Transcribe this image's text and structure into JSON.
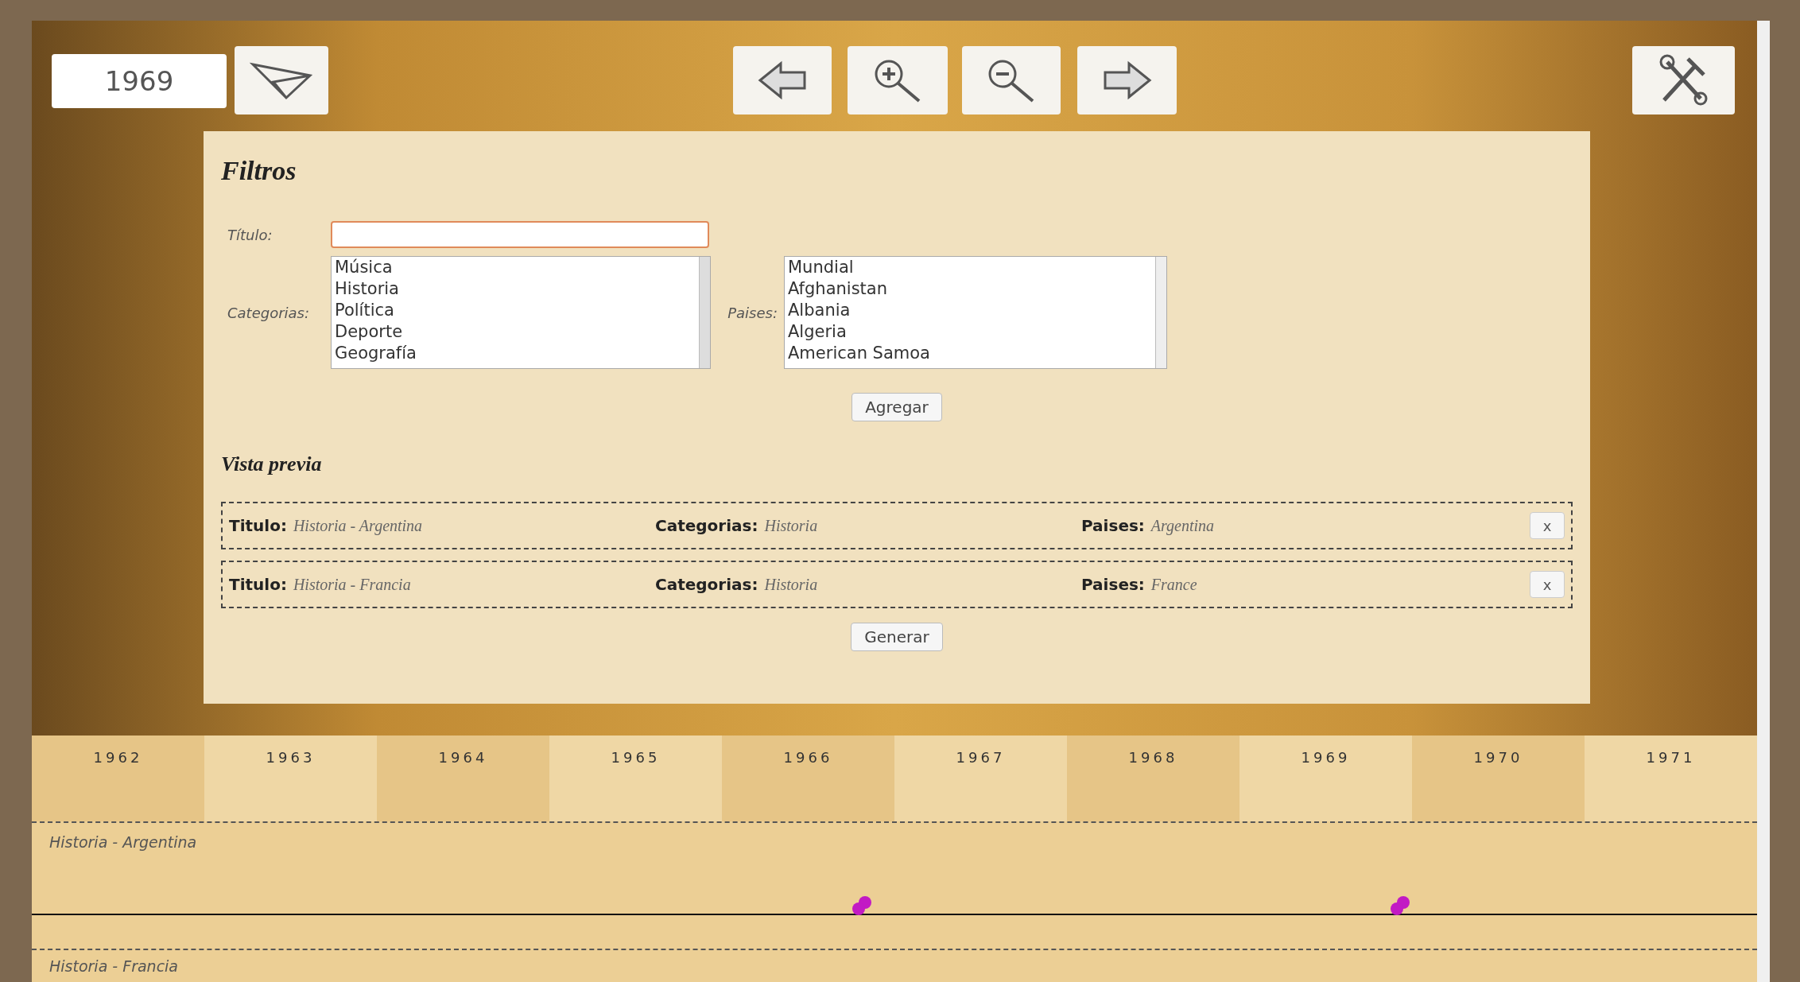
{
  "toolbar": {
    "year": "1969"
  },
  "filters": {
    "title": "Filtros",
    "title_field": {
      "label": "Título:"
    },
    "categories": {
      "label": "Categorias:",
      "options": [
        "Música",
        "Historia",
        "Política",
        "Deporte",
        "Geografía"
      ]
    },
    "countries": {
      "label": "Paises:",
      "options": [
        "Mundial",
        "Afghanistan",
        "Albania",
        "Algeria",
        "American Samoa"
      ]
    },
    "add_button": "Agregar",
    "preview_title": "Vista previa",
    "preview_rows": [
      {
        "title_label": "Titulo:",
        "title": "Historia - Argentina",
        "categories_label": "Categorias:",
        "categories": "Historia",
        "countries_label": "Paises:",
        "countries": "Argentina",
        "remove": "x"
      },
      {
        "title_label": "Titulo:",
        "title": "Historia - Francia",
        "categories_label": "Categorias:",
        "categories": "Historia",
        "countries_label": "Paises:",
        "countries": "France",
        "remove": "x"
      }
    ],
    "generate_button": "Generar"
  },
  "timeline": {
    "years": [
      "1962",
      "1963",
      "1964",
      "1965",
      "1966",
      "1967",
      "1968",
      "1969",
      "1970",
      "1971"
    ],
    "tracks": [
      "Historia - Argentina",
      "Historia - Francia"
    ]
  }
}
